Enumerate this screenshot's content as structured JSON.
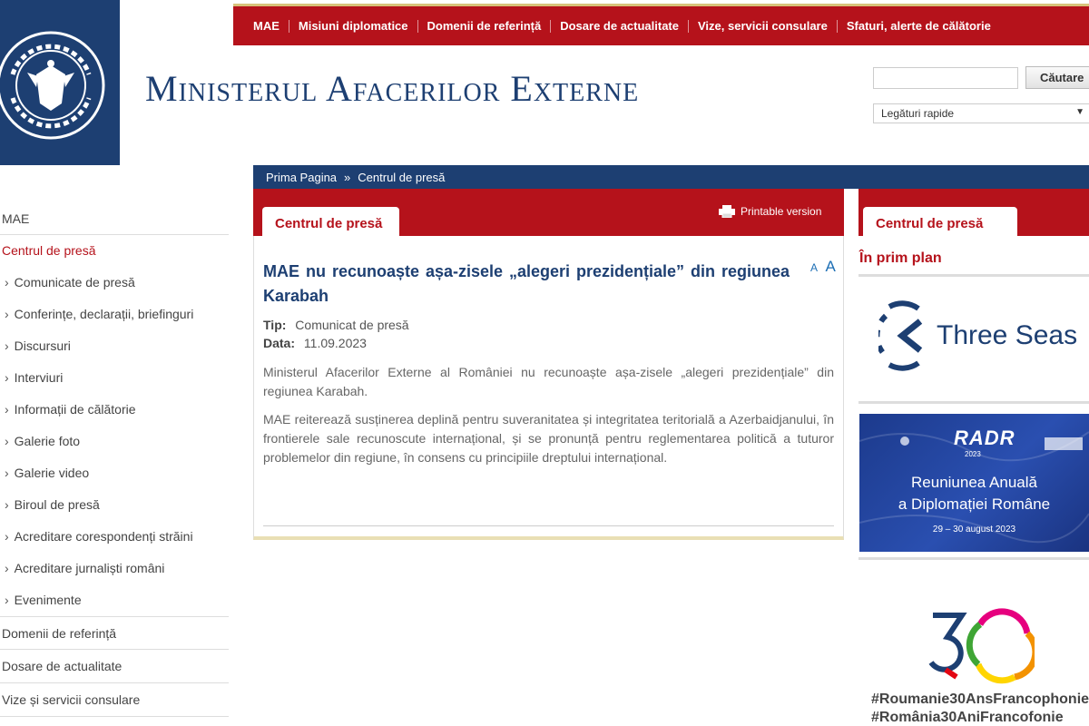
{
  "logo": {
    "seal_text": "GUVERNUL ROMÂNIEI"
  },
  "top_nav": [
    "MAE",
    "Misiuni diplomatice",
    "Domenii de referință",
    "Dosare de actualitate",
    "Vize, servicii consulare",
    "Sfaturi, alerte de călătorie"
  ],
  "header": {
    "title": "Ministerul Afacerilor Externe"
  },
  "search": {
    "placeholder": "",
    "button_label": "Căutare",
    "quick_links_label": "Legături rapide"
  },
  "breadcrumb": [
    "Prima Pagina",
    "Centrul de presă"
  ],
  "breadcrumb_separator": "»",
  "main": {
    "tab_label": "Centrul de presă",
    "printable_label": "Printable version",
    "font_small": "A",
    "font_large": "A",
    "article": {
      "title": "MAE nu recunoaște așa-zisele „alegeri prezidențiale” din regiunea Karabah",
      "type_label": "Tip:",
      "type_value": "Comunicat de presă",
      "date_label": "Data:",
      "date_value": "11.09.2023",
      "paragraph_1": "Ministerul Afacerilor Externe al României nu recunoaște așa-zisele „alegeri prezidențiale” din regiunea Karabah.",
      "paragraph_2": "MAE reiterează susținerea deplină pentru suveranitatea și integritatea teritorială a Azerbaidjanului, în frontierele sale recunoscute internațional, și se pronunță pentru reglementarea politică a tuturor problemelor din regiune, în consens cu principiile dreptului internațional."
    }
  },
  "sidebar": {
    "top": "MAE",
    "active": "Centrul de presă",
    "sub_items": [
      "Comunicate de presă",
      "Conferințe, declarații, briefinguri",
      "Discursuri",
      "Interviuri",
      "Informații de călătorie",
      "Galerie foto",
      "Galerie video",
      "Biroul de presă",
      "Acreditare corespondenți străini",
      "Acreditare jurnaliști români",
      "Evenimente"
    ],
    "bottom_items": [
      "Domenii de referință",
      "Dosare de actualitate",
      "Vize și servicii consulare"
    ]
  },
  "right_column": {
    "tab_label": "Centrul de presă",
    "heading": "În prim plan",
    "three_seas_text": "Three Seas",
    "radr": {
      "logo": "RADR",
      "year": "2023",
      "line1": "Reuniunea Anuală",
      "line2": "a Diplomației Române",
      "date": "29 – 30 august 2023"
    },
    "francophonie": {
      "hashtag_1": "#Roumanie30AnsFrancophonie",
      "hashtag_2": "#România30AniFrancofonie"
    }
  },
  "colors": {
    "navy": "#1d3f72",
    "red": "#b5121b",
    "radr_blue": "#2a4fb0"
  }
}
